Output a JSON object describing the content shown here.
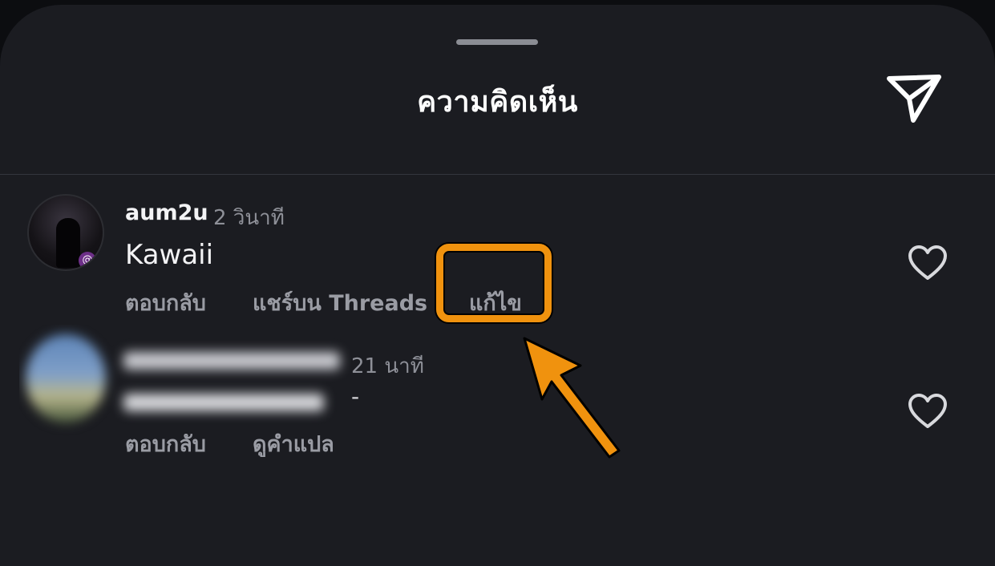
{
  "header": {
    "title": "ความคิดเห็น",
    "send_icon": "send-icon"
  },
  "comments": [
    {
      "username": "aum2u",
      "time": "2 วินาที",
      "text": "Kawaii",
      "actions": [
        "ตอบกลับ",
        "แชร์บน Threads",
        "แก้ไข"
      ]
    },
    {
      "time": "21 นาที",
      "text": "-",
      "actions": [
        "ตอบกลับ",
        "ดูคำแปล"
      ]
    }
  ],
  "colors": {
    "sheet_bg": "#1b1c21",
    "highlight": "#f0920e",
    "muted_text": "#9a9ca4"
  }
}
